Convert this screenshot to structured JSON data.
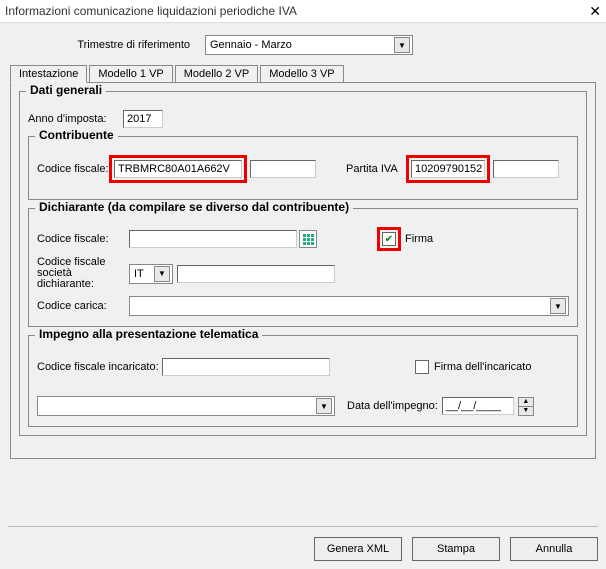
{
  "window": {
    "title": "Informazioni comunicazione liquidazioni periodiche IVA"
  },
  "trimestre": {
    "label": "Trimestre di riferimento",
    "value": "Gennaio - Marzo"
  },
  "tabs": [
    "Intestazione",
    "Modello 1 VP",
    "Modello 2 VP",
    "Modello 3 VP"
  ],
  "datiGenerali": {
    "legend": "Dati generali",
    "anno_label": "Anno d'imposta:",
    "anno_value": "2017"
  },
  "contribuente": {
    "legend": "Contribuente",
    "cf_label": "Codice fiscale:",
    "cf_value": "TRBMRC80A01A662V",
    "piva_label": "Partita IVA",
    "piva_value": "10209790152"
  },
  "dichiarante": {
    "legend": "Dichiarante (da compilare se diverso dal contribuente)",
    "cf_label": "Codice fiscale:",
    "cf_value": "",
    "firma_label": "Firma",
    "firma_checked": true,
    "cf_soc_label": "Codice fiscale società dichiarante:",
    "cf_soc_country": "IT",
    "cf_soc_value": "",
    "carica_label": "Codice carica:",
    "carica_value": ""
  },
  "impegno": {
    "legend": "Impegno alla presentazione telematica",
    "cf_incaricato_label": "Codice fiscale incaricato:",
    "cf_incaricato_value": "",
    "firma_incaricato_label": "Firma dell'incaricato",
    "firma_incaricato_checked": false,
    "select_value": "",
    "data_label": "Data dell'impegno:",
    "data_value": "__/__/____"
  },
  "buttons": {
    "genera": "Genera XML",
    "stampa": "Stampa",
    "annulla": "Annulla"
  }
}
